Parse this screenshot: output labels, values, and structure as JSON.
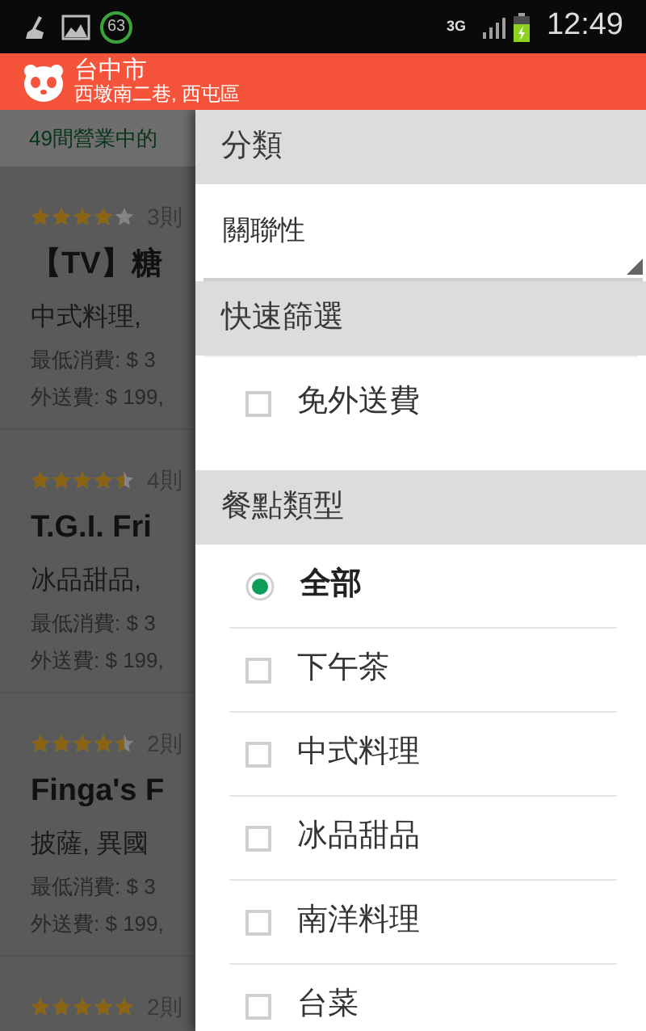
{
  "status_bar": {
    "badge": "63",
    "network": "3G",
    "time": "12:49"
  },
  "app_bar": {
    "title": "台中市",
    "subtitle": "西墩南二巷, 西屯區"
  },
  "list_header": "49間營業中的",
  "restaurants": [
    {
      "stars": 4,
      "reviews": "3則",
      "name": "【TV】糖",
      "cuisine": "中式料理,",
      "min_order": "最低消費: $ 3",
      "delivery_fee": "外送費: $ 199,"
    },
    {
      "stars": 4.5,
      "reviews": "4則",
      "name": "T.G.I. Fri",
      "cuisine": "冰品甜品,",
      "min_order": "最低消費: $ 3",
      "delivery_fee": "外送費: $ 199,"
    },
    {
      "stars": 4.5,
      "reviews": "2則",
      "name": "Finga's F",
      "cuisine": "披薩, 異國",
      "min_order": "最低消費: $ 3",
      "delivery_fee": "外送費: $ 199,"
    },
    {
      "stars": 5,
      "reviews": "2則"
    }
  ],
  "filter_drawer": {
    "sections": [
      {
        "title": "分類",
        "items": [
          {
            "kind": "dropdown",
            "value": "關聯性"
          }
        ]
      },
      {
        "title": "快速篩選",
        "items": [
          {
            "kind": "checkbox",
            "label": "免外送費",
            "checked": false
          }
        ]
      },
      {
        "title": "餐點類型",
        "items": [
          {
            "kind": "radio",
            "label": "全部",
            "selected": true
          },
          {
            "kind": "checkbox",
            "label": "下午茶",
            "checked": false
          },
          {
            "kind": "checkbox",
            "label": "中式料理",
            "checked": false
          },
          {
            "kind": "checkbox",
            "label": "冰品甜品",
            "checked": false
          },
          {
            "kind": "checkbox",
            "label": "南洋料理",
            "checked": false
          },
          {
            "kind": "checkbox",
            "label": "台菜",
            "checked": false
          }
        ]
      }
    ]
  }
}
